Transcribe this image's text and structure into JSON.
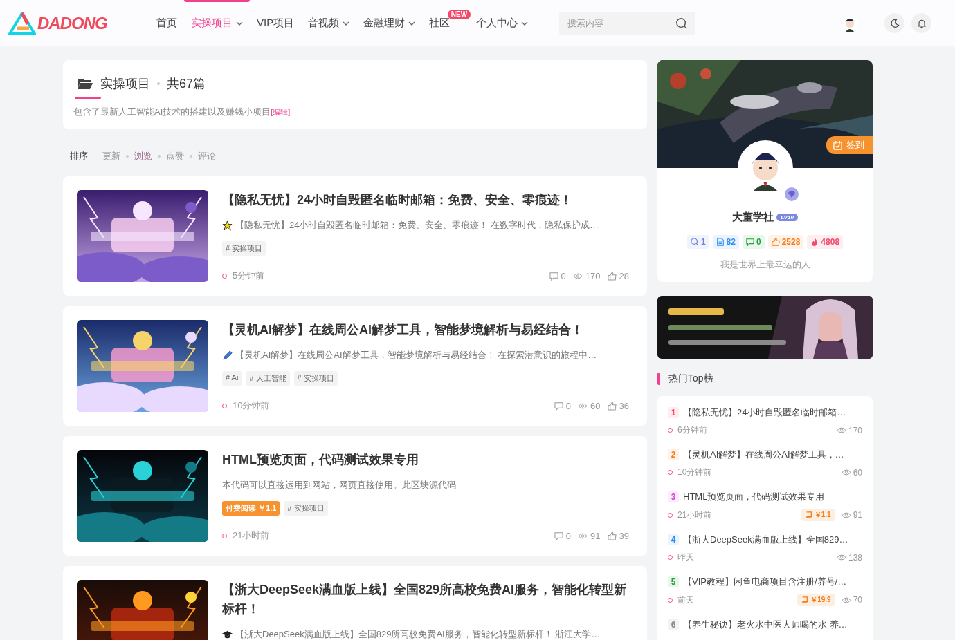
{
  "header": {
    "logo": "DADONG",
    "nav": [
      {
        "label": "首页",
        "selected": false,
        "dropdown": false
      },
      {
        "label": "实操项目",
        "selected": true,
        "dropdown": true
      },
      {
        "label": "VIP项目",
        "selected": false,
        "dropdown": false
      },
      {
        "label": "音视频",
        "selected": false,
        "dropdown": true
      },
      {
        "label": "金融理财",
        "selected": false,
        "dropdown": true
      },
      {
        "label": "社区",
        "selected": false,
        "dropdown": false,
        "badge": "NEW"
      },
      {
        "label": "个人中心",
        "selected": false,
        "dropdown": true
      }
    ],
    "search": {
      "placeholder": "搜索内容"
    }
  },
  "category": {
    "name": "实操项目",
    "count": "共67篇",
    "description": "包含了最新人工智能AI技术的搭建以及赚钱小项目",
    "edit": "[编辑]"
  },
  "sort": {
    "label": "排序",
    "options": [
      {
        "label": "更新",
        "selected": false
      },
      {
        "label": "浏览",
        "selected": true
      },
      {
        "label": "点赞",
        "selected": false
      },
      {
        "label": "评论",
        "selected": false
      }
    ]
  },
  "posts": [
    {
      "title": "【隐私无忧】24小时自毁匿名临时邮箱：免费、安全、零痕迹！",
      "excerpt": "【隐私无忧】24小时自毁匿名临时邮箱：免费、安全、零痕迹！ 在数字时代，隐私保护成…",
      "tags": [
        {
          "kind": "tag",
          "label": "# 实操项目"
        }
      ],
      "time": "5分钟前",
      "comments": "0",
      "views": "170",
      "likes": "28"
    },
    {
      "title": "【灵机AI解梦】在线周公AI解梦工具，智能梦境解析与易经结合！",
      "excerpt": "【灵机AI解梦】在线周公AI解梦工具，智能梦境解析与易经结合！ 在探索潜意识的旅程中…",
      "tags": [
        {
          "kind": "tag",
          "label": "# Ai"
        },
        {
          "kind": "tag",
          "label": "# 人工智能"
        },
        {
          "kind": "tag",
          "label": "# 实操项目"
        }
      ],
      "time": "10分钟前",
      "comments": "0",
      "views": "60",
      "likes": "36"
    },
    {
      "title": "HTML预览页面，代码测试效果专用",
      "excerpt": "本代码可以直接运用到网站，网页直接使用。此区块源代码",
      "tags": [
        {
          "kind": "paid",
          "label": "付费阅读 ￥1.1"
        },
        {
          "kind": "tag",
          "label": "# 实操项目"
        }
      ],
      "time": "21小时前",
      "comments": "0",
      "views": "91",
      "likes": "39"
    },
    {
      "title": "【浙大DeepSeek满血版上线】全国829所高校免费AI服务，智能化转型新标杆！",
      "excerpt": "【浙大DeepSeek满血版上线】全国829所高校免费AI服务，智能化转型新标杆！ 浙江大学…"
    }
  ],
  "profile": {
    "checkin": "签到",
    "name": "大董学社",
    "level": "LV10",
    "stats": [
      {
        "kind": "comments",
        "value": "1",
        "color": "#6c7fe0"
      },
      {
        "kind": "posts",
        "value": "82",
        "color": "#2f8ff0"
      },
      {
        "kind": "messages",
        "value": "0",
        "color": "#22a33a"
      },
      {
        "kind": "likes",
        "value": "2528",
        "color": "#f57a12"
      },
      {
        "kind": "hot",
        "value": "4808",
        "color": "#f2486a"
      }
    ],
    "bio": "我是世界上最幸运的人"
  },
  "hot": {
    "title": "热门Top榜",
    "items": [
      {
        "rank": "1",
        "color": "#f2486a",
        "title": "【隐私无忧】24小时自毁匿名临时邮箱…",
        "time": "6分钟前",
        "views": "170"
      },
      {
        "rank": "2",
        "color": "#f57a12",
        "title": "【灵机AI解梦】在线周公AI解梦工具，…",
        "time": "10分钟前",
        "views": "60"
      },
      {
        "rank": "3",
        "color": "#d63fd6",
        "title": "HTML预览页面，代码测试效果专用",
        "time": "21小时前",
        "price": "￥1.1",
        "views": "91"
      },
      {
        "rank": "4",
        "color": "#2f8ff0",
        "title": "【浙大DeepSeek满血版上线】全国829…",
        "time": "昨天",
        "views": "138"
      },
      {
        "rank": "5",
        "color": "#22a33a",
        "title": "【VIP教程】闲鱼电商项目含注册/养号/…",
        "time": "前天",
        "price": "￥19.9",
        "views": "70"
      },
      {
        "rank": "6",
        "color": "#888888",
        "title": "【养生秘诀】老火水中医大师喝的水 养…"
      }
    ]
  }
}
